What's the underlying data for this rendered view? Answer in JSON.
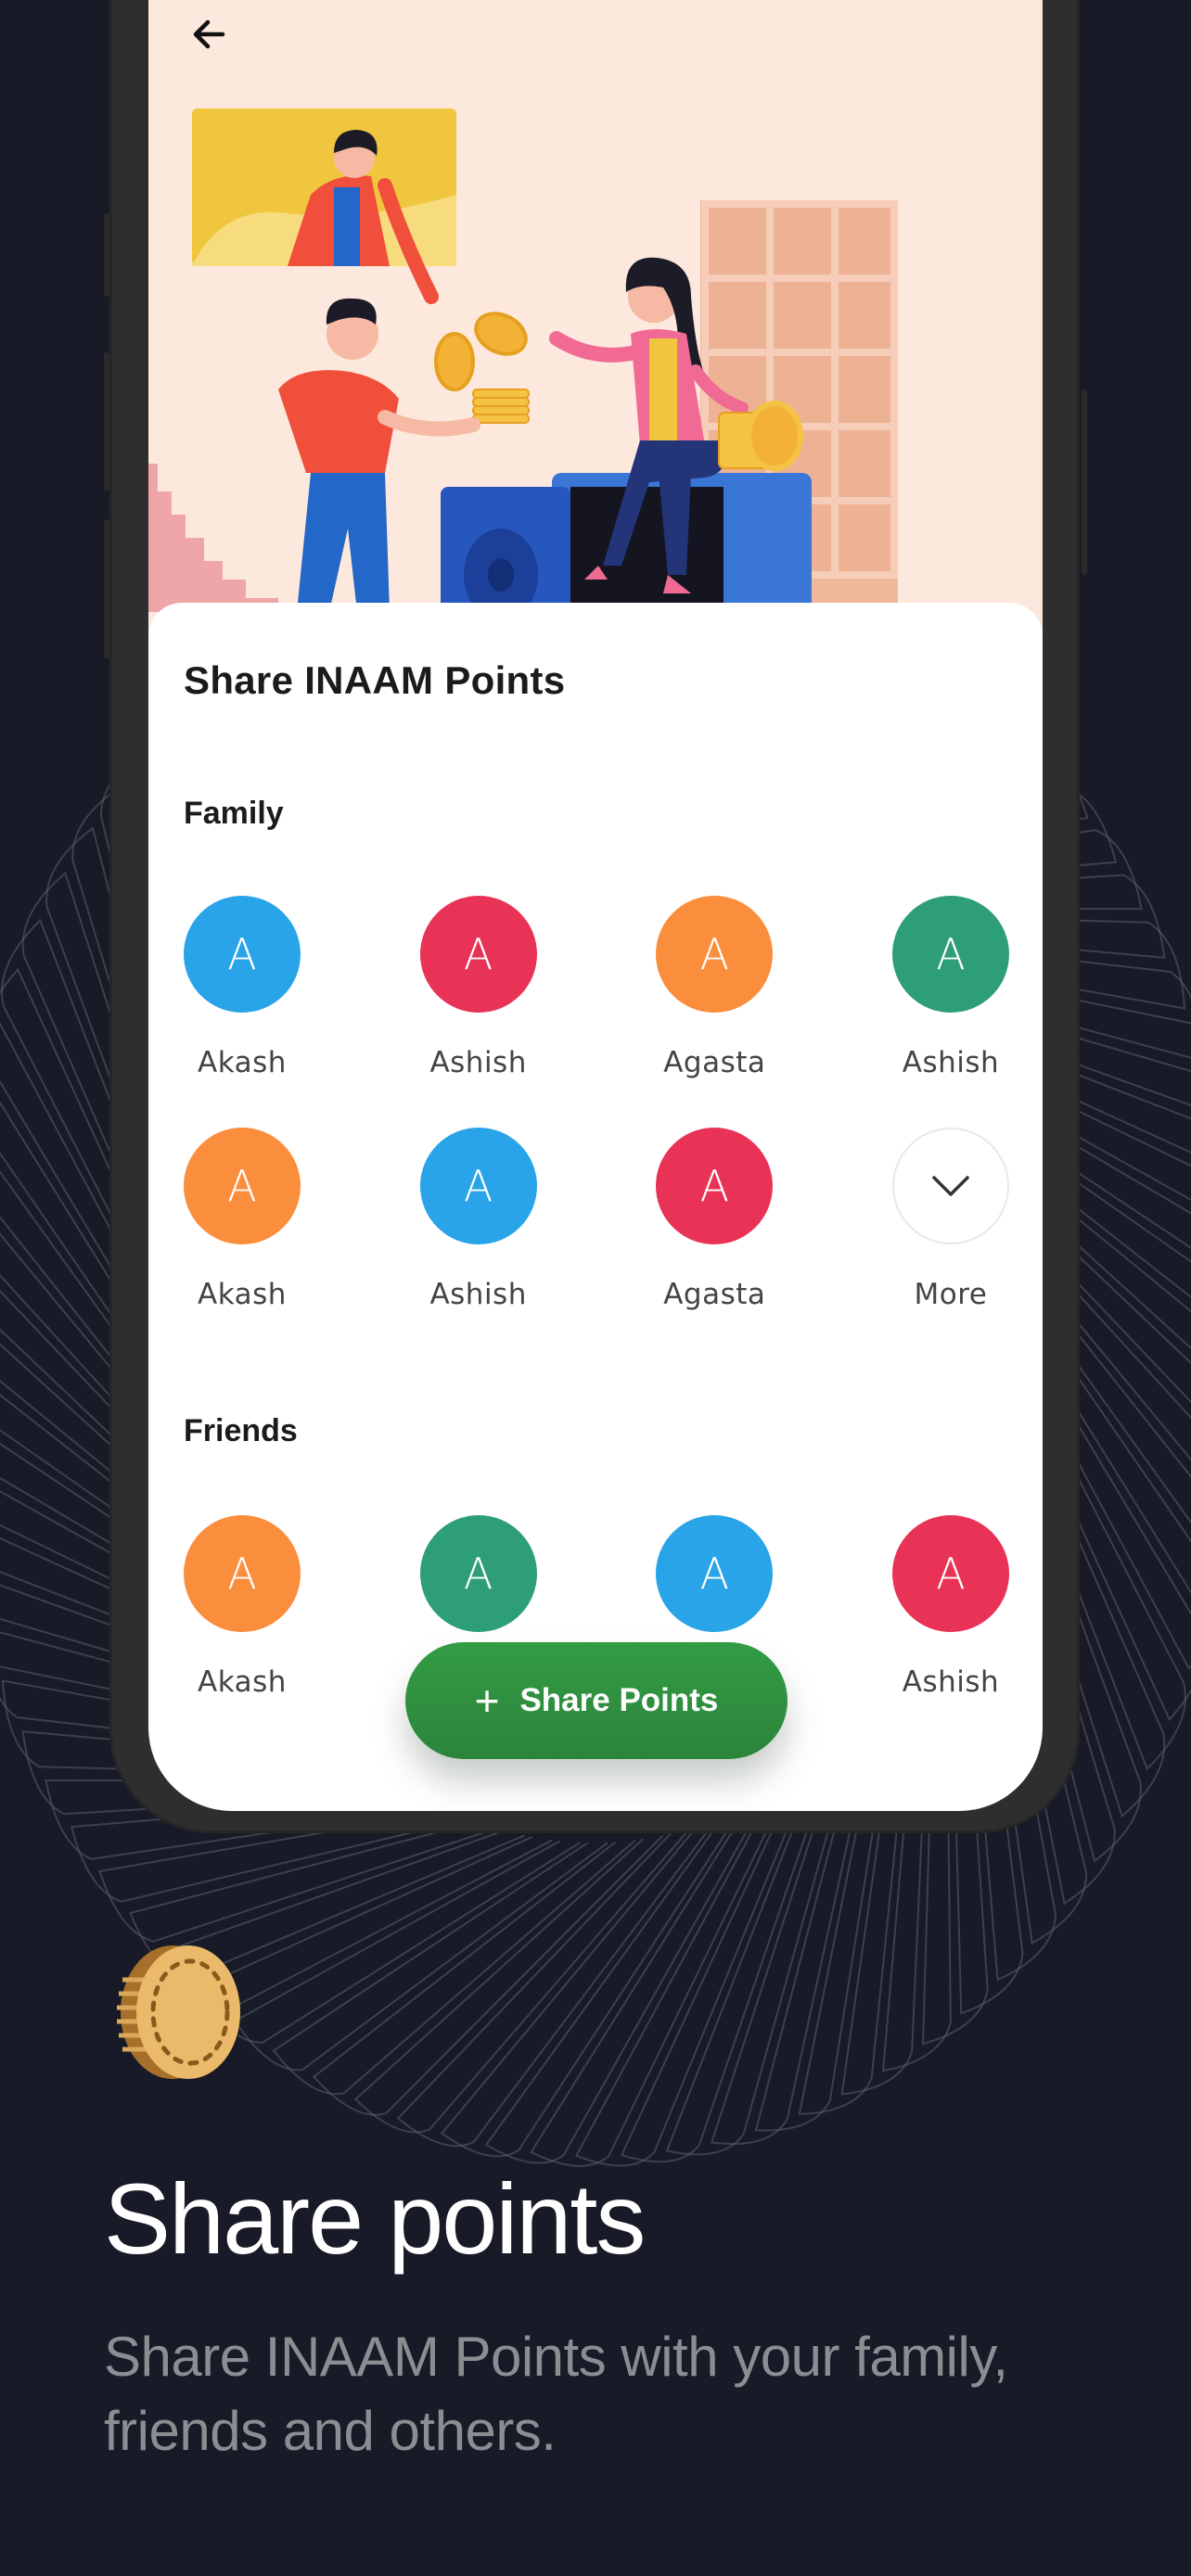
{
  "screen": {
    "back_label": "Back",
    "card": {
      "title": "Share INAAM Points",
      "sections": [
        {
          "label": "Family",
          "rows": [
            [
              {
                "initial": "A",
                "name": "Akash",
                "color": "#29a4e8"
              },
              {
                "initial": "A",
                "name": "Ashish",
                "color": "#e93356"
              },
              {
                "initial": "A",
                "name": "Agasta",
                "color": "#fa8e3c"
              },
              {
                "initial": "A",
                "name": "Ashish",
                "color": "#2e9e76"
              }
            ],
            [
              {
                "initial": "A",
                "name": "Akash",
                "color": "#fa8e3c"
              },
              {
                "initial": "A",
                "name": "Ashish",
                "color": "#29a4e8"
              },
              {
                "initial": "A",
                "name": "Agasta",
                "color": "#e93356"
              },
              {
                "initial": "",
                "name": "More",
                "icon": "chevron-down-icon"
              }
            ]
          ]
        },
        {
          "label": "Friends",
          "rows": [
            [
              {
                "initial": "A",
                "name": "Akash",
                "color": "#fa8e3c"
              },
              {
                "initial": "A",
                "name": "",
                "color": "#2e9e76"
              },
              {
                "initial": "A",
                "name": "",
                "color": "#29a4e8"
              },
              {
                "initial": "A",
                "name": "Ashish",
                "color": "#e93356"
              }
            ]
          ]
        }
      ],
      "share_button": {
        "icon": "plus-icon",
        "label": "Share Points",
        "color": "#2f8f3f"
      }
    }
  },
  "promo": {
    "title": "Share points",
    "subtitle": "Share INAAM Points with your family, friends and others."
  },
  "colors": {
    "background": "#181b27",
    "illustration_bg": "#fce8dc",
    "accent_green": "#2f8f3f"
  }
}
